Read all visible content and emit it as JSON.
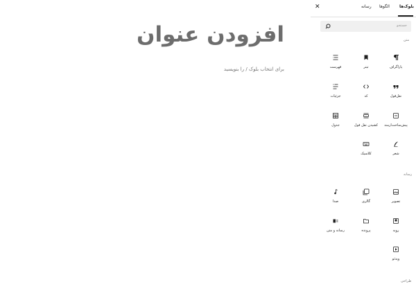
{
  "tabs": {
    "blocks": "بلوک‌ها",
    "patterns": "الگوها",
    "media": "رسانه"
  },
  "search": {
    "placeholder": "جستجو"
  },
  "categories": {
    "text": "متن",
    "media": "رسانه",
    "design": "طراحی"
  },
  "blocks": {
    "paragraph": "پاراگراف",
    "heading": "تیتر",
    "list": "فهرست",
    "quote": "نقل‌قول",
    "code": "کد",
    "details": "جزئیات",
    "preformatted": "پیش‌ساخت‌ارمند",
    "pullquote": "کشیدن نقل قول",
    "table": "جدول",
    "verse": "شعر",
    "classic": "کلاسیک",
    "image": "تصویر",
    "gallery": "گالری",
    "audio": "صدا",
    "cover": "رویه",
    "file": "پرونده",
    "media_text": "رسانه و متن",
    "video": "ویدئو"
  },
  "editor": {
    "title": "افزودن عنوان",
    "hint": "برای انتخاب بلوک / را بنویسید"
  },
  "colors": {
    "accent": "#1e1e1e",
    "muted": "#757575",
    "title": "#6d6d6d"
  }
}
